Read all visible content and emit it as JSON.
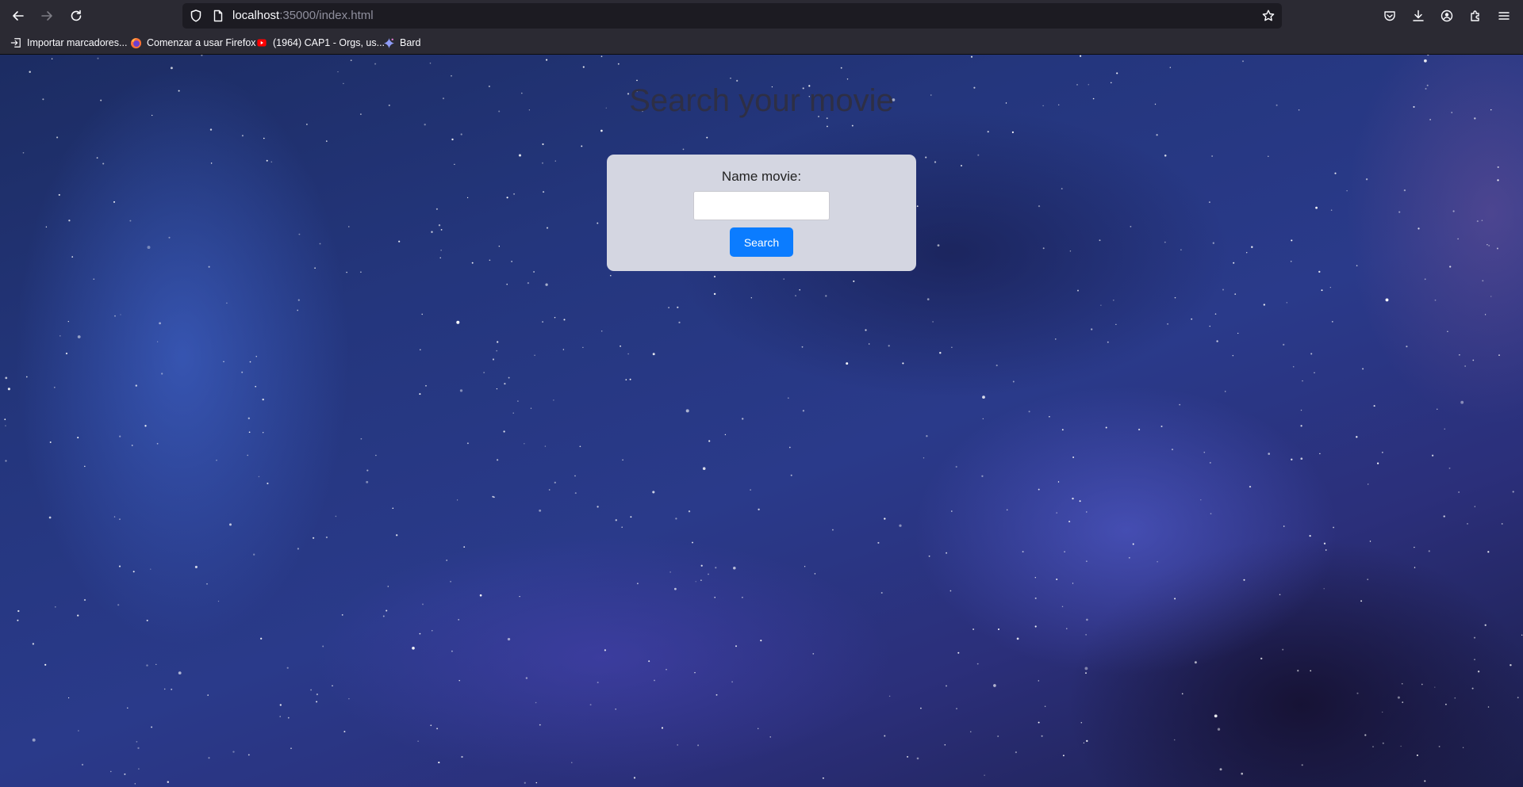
{
  "browser": {
    "url_host": "localhost",
    "url_rest": ":35000/index.html",
    "bookmarks": [
      {
        "label": "Importar marcadores...",
        "icon": "import-icon"
      },
      {
        "label": "Comenzar a usar Firefox",
        "icon": "firefox-icon"
      },
      {
        "label": "(1964) CAP1 - Orgs, us...",
        "icon": "youtube-icon"
      },
      {
        "label": "Bard",
        "icon": "bard-icon"
      }
    ]
  },
  "page": {
    "title": "Search your movie",
    "form": {
      "label": "Name movie:",
      "input_value": "",
      "button_label": "Search"
    }
  },
  "colors": {
    "button": "#0b7cff",
    "card": "#d4d6e1",
    "title": "#2e2f45"
  }
}
